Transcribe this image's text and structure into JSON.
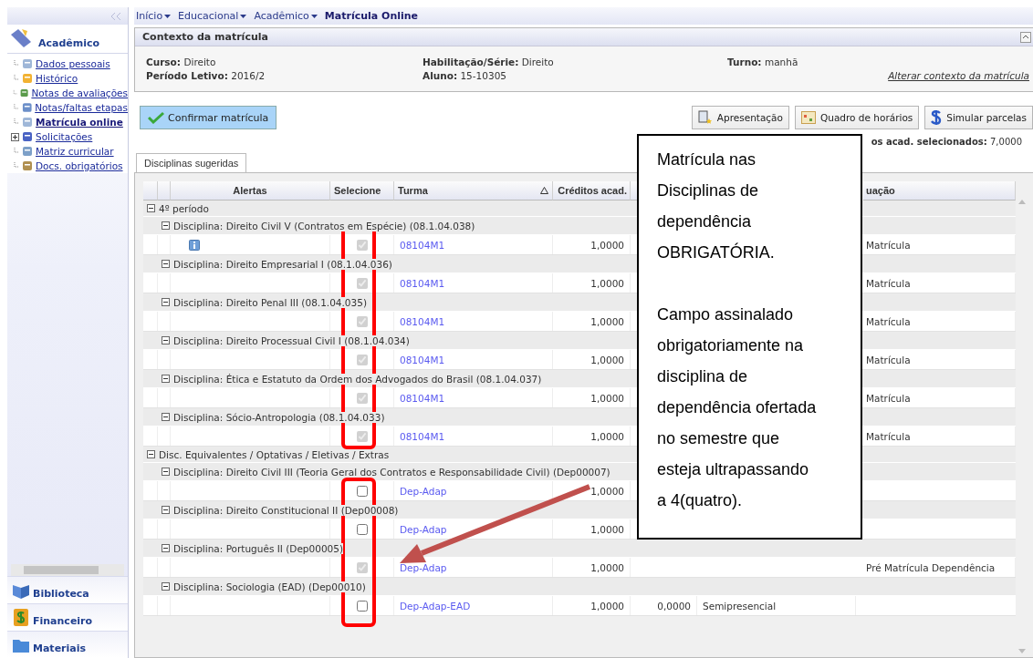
{
  "breadcrumb": [
    {
      "label": "Início",
      "kind": "menu"
    },
    {
      "label": "Educacional",
      "kind": "menu"
    },
    {
      "label": "Acadêmico",
      "kind": "menu"
    },
    {
      "label": "Matrícula Online",
      "kind": "current"
    }
  ],
  "sidebar": {
    "section": "Acadêmico",
    "items": [
      {
        "label": "Dados pessoais",
        "selected": false
      },
      {
        "label": "Histórico",
        "selected": false
      },
      {
        "label": "Notas de avaliações",
        "selected": false
      },
      {
        "label": "Notas/faltas etapas",
        "selected": false
      },
      {
        "label": "Matrícula online",
        "selected": true
      },
      {
        "label": "Solicitações",
        "selected": false,
        "expanded": false
      },
      {
        "label": "Matriz curricular",
        "selected": false
      },
      {
        "label": "Docs. obrigatórios",
        "selected": false
      }
    ],
    "modules": [
      "Biblioteca",
      "Financeiro",
      "Materiais"
    ]
  },
  "context": {
    "title": "Contexto da matrícula",
    "fields": [
      {
        "label": "Curso:",
        "value": "Direito"
      },
      {
        "label": "Habilitação/Série:",
        "value": "Direito"
      },
      {
        "label": "Turno:",
        "value": "manhã"
      },
      {
        "label": "Período Letivo:",
        "value": "2016/2"
      },
      {
        "label": "Aluno:",
        "value": "15-10305"
      }
    ],
    "link": "Alterar contexto da matrícula"
  },
  "confirm_button": "Confirmar matrícula",
  "actions": [
    "Apresentação",
    "Quadro de horários",
    "Simular parcelas"
  ],
  "credits_summary": {
    "label": "os acad. selecionados:",
    "value": "7,0000"
  },
  "tabs": [
    {
      "label": "Disciplinas sugeridas",
      "selected": true
    }
  ],
  "table": {
    "headers": {
      "alertas": "Alertas",
      "selecione": "Selecione",
      "turma": "Turma",
      "creditos": "Créditos acad.",
      "column_8": "uação"
    },
    "turma_sort_ascending": true,
    "groups": [
      {
        "label": "4º período",
        "expanded": true,
        "disciplines": [
          {
            "label": "Disciplina: Direito Civil V (Contratos em Espécie) (08.1.04.038)",
            "expanded": true,
            "alert": true,
            "checked": true,
            "disabled": true,
            "turma": "08104M1",
            "credits": "1,0000",
            "status": "Matrícula"
          },
          {
            "label": "Disciplina: Direito Empresarial I (08.1.04.036)",
            "expanded": true,
            "alert": false,
            "checked": true,
            "disabled": true,
            "turma": "08104M1",
            "credits": "1,0000",
            "status": "Matrícula"
          },
          {
            "label": "Disciplina: Direito Penal III (08.1.04.035)",
            "expanded": true,
            "alert": false,
            "checked": true,
            "disabled": true,
            "turma": "08104M1",
            "credits": "1,0000",
            "status": "Matrícula"
          },
          {
            "label": "Disciplina: Direito Processual Civil I (08.1.04.034)",
            "expanded": true,
            "alert": false,
            "checked": true,
            "disabled": true,
            "turma": "08104M1",
            "credits": "1,0000",
            "status": "Matrícula"
          },
          {
            "label": "Disciplina: Ética e Estatuto da Ordem dos Advogados do Brasil (08.1.04.037)",
            "expanded": true,
            "alert": false,
            "checked": true,
            "disabled": true,
            "turma": "08104M1",
            "credits": "1,0000",
            "status": "Matrícula"
          },
          {
            "label": "Disciplina: Sócio-Antropologia (08.1.04.033)",
            "expanded": true,
            "alert": false,
            "checked": true,
            "disabled": true,
            "turma": "08104M1",
            "credits": "1,0000",
            "status": "Matrícula"
          }
        ]
      },
      {
        "label": "Disc. Equivalentes / Optativas / Eletivas / Extras",
        "expanded": true,
        "disciplines": [
          {
            "label": "Disciplina: Direito Civil III (Teoria Geral dos Contratos e Responsabilidade Civil) (Dep00007)",
            "expanded": true,
            "alert": false,
            "checked": false,
            "disabled": false,
            "turma": "Dep-Adap",
            "credits": "1,0000"
          },
          {
            "label": "Disciplina: Direito Constitucional II (Dep00008)",
            "expanded": true,
            "alert": false,
            "checked": false,
            "disabled": false,
            "turma": "Dep-Adap",
            "credits": "1,0000"
          },
          {
            "label": "Disciplina: Português II (Dep00005)",
            "expanded": true,
            "alert": false,
            "checked": true,
            "disabled": true,
            "turma": "Dep-Adap",
            "credits": "1,0000",
            "status": "Pré Matrícula Dependência"
          },
          {
            "label": "Disciplina: Sociologia (EAD) (Dep00010)",
            "expanded": true,
            "alert": false,
            "checked": false,
            "disabled": false,
            "turma": "Dep-Adap-EAD",
            "credits": "1,0000",
            "column_6": "0,0000",
            "column_7": "Semipresencial"
          }
        ]
      }
    ]
  },
  "callout": {
    "paragraphs": [
      "Matrícula nas Disciplinas de dependência OBRIGATÓRIA.",
      "Campo assinalado obrigatoriamente na disciplina de dependência ofertada no semestre que esteja ultrapassando a 4(quatro)."
    ]
  }
}
